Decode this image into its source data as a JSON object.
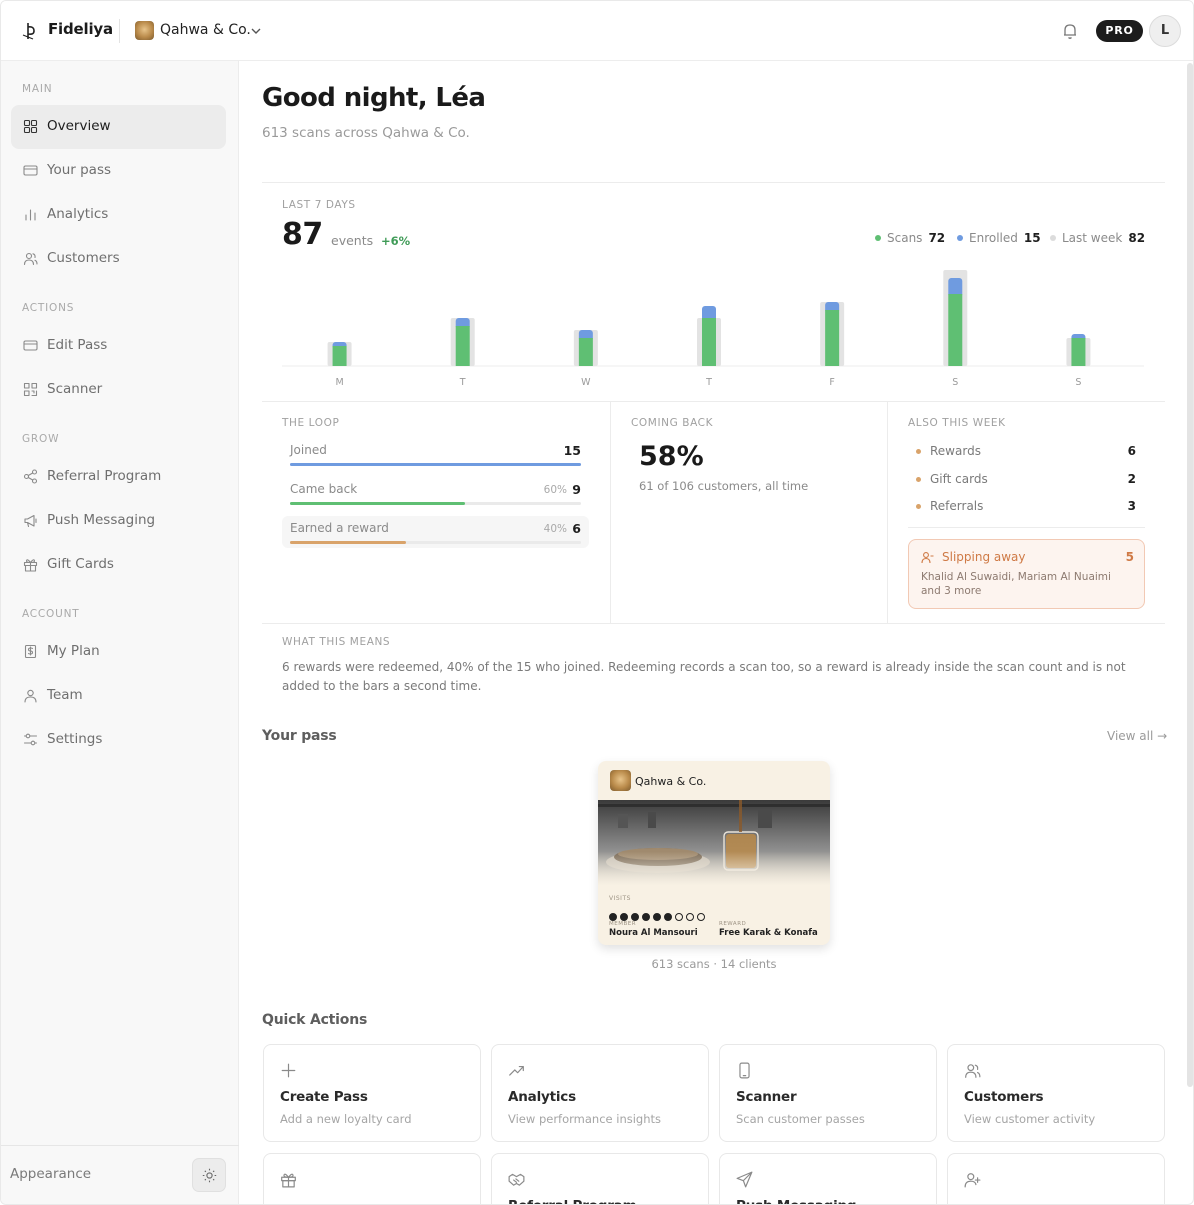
{
  "app": {
    "name": "Fideliya",
    "workspace": "Qahwa & Co.",
    "plan_badge": "PRO",
    "user_initial": "L"
  },
  "sidebar": {
    "sections": [
      {
        "label": "MAIN",
        "items": [
          {
            "label": "Overview",
            "icon": "grid-icon",
            "active": true
          },
          {
            "label": "Your pass",
            "icon": "card-icon"
          },
          {
            "label": "Analytics",
            "icon": "bar-chart-icon"
          },
          {
            "label": "Customers",
            "icon": "users-icon"
          }
        ]
      },
      {
        "label": "ACTIONS",
        "items": [
          {
            "label": "Edit Pass",
            "icon": "card-icon"
          },
          {
            "label": "Scanner",
            "icon": "qr-icon"
          }
        ]
      },
      {
        "label": "GROW",
        "items": [
          {
            "label": "Referral Program",
            "icon": "share-icon"
          },
          {
            "label": "Push Messaging",
            "icon": "megaphone-icon"
          },
          {
            "label": "Gift Cards",
            "icon": "gift-icon"
          }
        ]
      },
      {
        "label": "ACCOUNT",
        "items": [
          {
            "label": "My Plan",
            "icon": "dollar-doc-icon"
          },
          {
            "label": "Team",
            "icon": "user-icon"
          },
          {
            "label": "Settings",
            "icon": "sliders-icon"
          }
        ]
      }
    ],
    "appearance_label": "Appearance"
  },
  "header": {
    "greeting": "Good night, Léa",
    "subtitle": "613 scans across Qahwa & Co."
  },
  "weekly": {
    "caption": "LAST 7 DAYS",
    "total": "87",
    "unit": "events",
    "delta": "+6%",
    "legend": [
      {
        "label": "Scans",
        "value": "72",
        "color": "#5fbf73"
      },
      {
        "label": "Enrolled",
        "value": "15",
        "color": "#6f9be0"
      },
      {
        "label": "Last week",
        "value": "82",
        "color": "#dcdcdc"
      }
    ]
  },
  "chart_data": {
    "type": "bar",
    "categories": [
      "M",
      "T",
      "W",
      "T",
      "F",
      "S",
      "S"
    ],
    "series": [
      {
        "name": "Scans",
        "values": [
          5,
          10,
          7,
          12,
          14,
          18,
          7
        ]
      },
      {
        "name": "Enrolled",
        "values": [
          1,
          2,
          2,
          3,
          2,
          4,
          1
        ]
      },
      {
        "name": "Last week",
        "values": [
          6,
          12,
          9,
          12,
          16,
          24,
          7
        ]
      }
    ],
    "colors": {
      "Scans": "#5fbf73",
      "Enrolled": "#6f9be0",
      "Last week": "#e3e3e3"
    },
    "stacked": [
      "Scans",
      "Enrolled"
    ],
    "ylim": [
      0,
      24
    ],
    "grid": false,
    "legend": "top-right"
  },
  "loop": {
    "caption": "THE LOOP",
    "rows": [
      {
        "label": "Joined",
        "pct": "",
        "value": "15",
        "fraction": 1.0,
        "color": "#6f9be0"
      },
      {
        "label": "Came back",
        "pct": "60%",
        "value": "9",
        "fraction": 0.6,
        "color": "#5fbf73"
      },
      {
        "label": "Earned a reward",
        "pct": "40%",
        "value": "6",
        "fraction": 0.4,
        "color": "#d9a36a"
      }
    ]
  },
  "coming_back": {
    "caption": "COMING BACK",
    "value": "58%",
    "detail": "61 of 106 customers, all time"
  },
  "also": {
    "caption": "ALSO THIS WEEK",
    "rows": [
      {
        "label": "Rewards",
        "value": "6"
      },
      {
        "label": "Gift cards",
        "value": "2"
      },
      {
        "label": "Referrals",
        "value": "3"
      }
    ],
    "slipping": {
      "title": "Slipping away",
      "count": "5",
      "detail": "Khalid Al Suwaidi, Mariam Al Nuaimi and 3 more"
    }
  },
  "meaning": {
    "caption": "WHAT THIS MEANS",
    "text": "6 rewards were redeemed, 40% of the 15 who joined. Redeeming records a scan too, so a reward is already inside the scan count and is not added to the bars a second time."
  },
  "pass_section": {
    "title": "Your pass",
    "view_all": "View all →",
    "card": {
      "brand": "Qahwa & Co.",
      "visits_caption": "VISITS",
      "stamps_total": 9,
      "stamps_filled": 6,
      "member_caption": "MEMBER",
      "member": "Noura Al Mansouri",
      "reward_caption": "REWARD",
      "reward": "Free Karak & Konafa"
    },
    "footer": "613 scans · 14 clients"
  },
  "quick_actions": {
    "title": "Quick Actions",
    "cards": [
      {
        "title": "Create Pass",
        "desc": "Add a new loyalty card",
        "icon": "plus-icon"
      },
      {
        "title": "Analytics",
        "desc": "View performance insights",
        "icon": "trend-up-icon"
      },
      {
        "title": "Scanner",
        "desc": "Scan customer passes",
        "icon": "phone-icon"
      },
      {
        "title": "Customers",
        "desc": "View customer activity",
        "icon": "users-icon"
      },
      {
        "title": "",
        "desc": "",
        "icon": "gift-icon"
      },
      {
        "title": "Referral Program",
        "desc": "",
        "icon": "handshake-icon"
      },
      {
        "title": "Push Messaging",
        "desc": "",
        "icon": "send-icon"
      },
      {
        "title": "",
        "desc": "",
        "icon": "user-plus-icon"
      }
    ]
  }
}
